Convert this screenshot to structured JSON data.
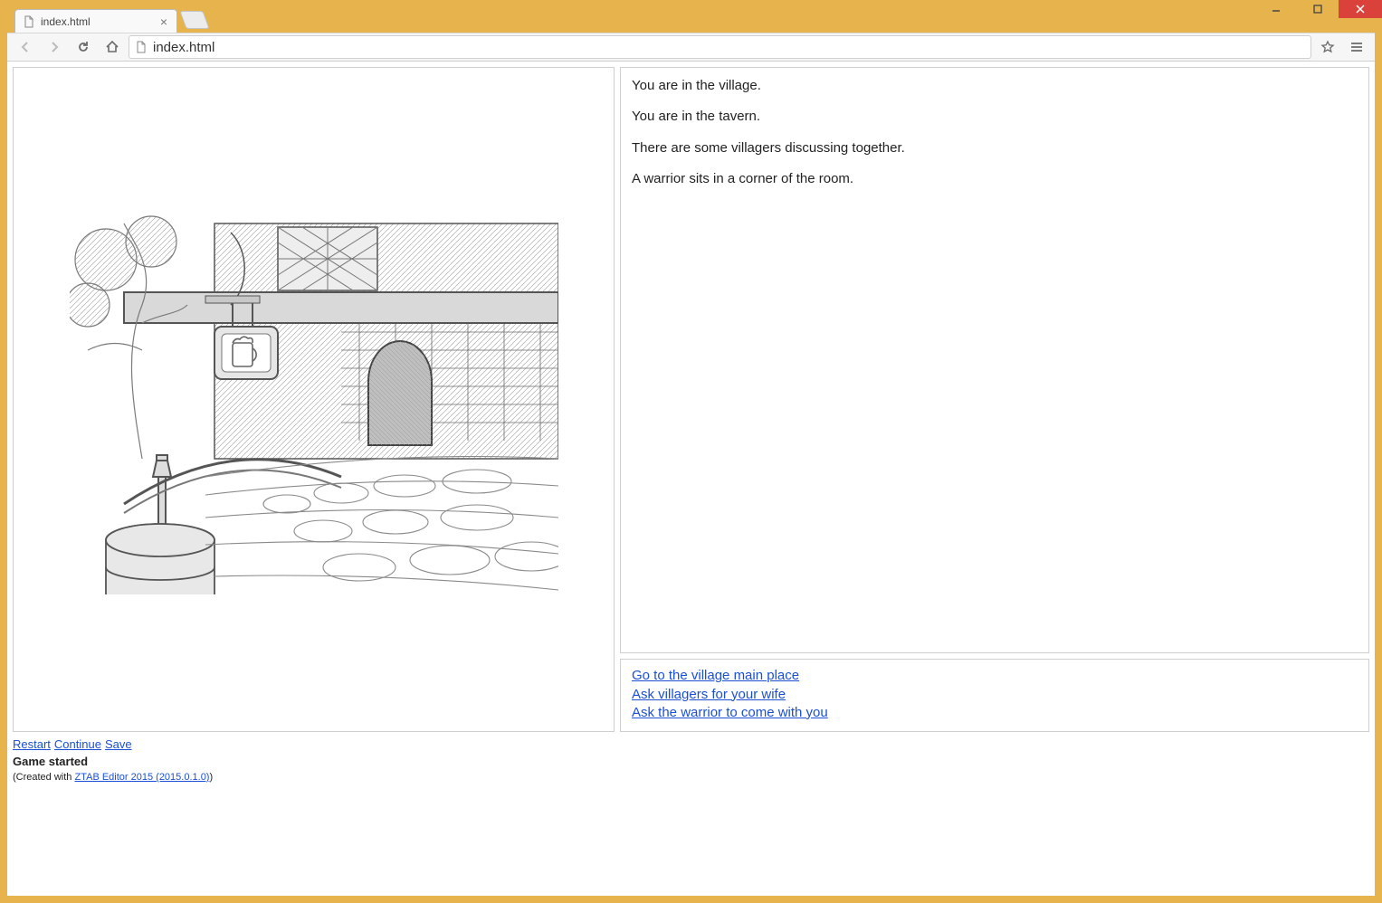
{
  "window": {
    "tab_title": "index.html",
    "url_text": "index.html"
  },
  "story": {
    "paragraphs": [
      "You are in the village.",
      "You are in the tavern.",
      "There are some villagers discussing together.",
      "A warrior sits in a corner of the room."
    ]
  },
  "choices": [
    "Go to the village main place",
    "Ask villagers for your wife",
    "Ask the warrior to come with you"
  ],
  "controls": {
    "restart": "Restart",
    "continue": "Continue",
    "save": "Save"
  },
  "status": "Game started",
  "credit": {
    "prefix": "(Created with ",
    "link": "ZTAB Editor 2015 (2015.0.1.0)",
    "suffix": ")"
  }
}
